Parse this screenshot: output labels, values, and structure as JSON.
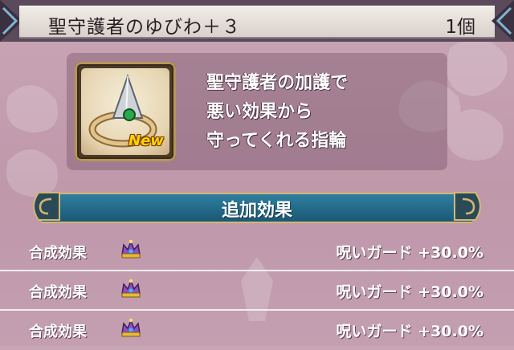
{
  "item": {
    "name": "聖守護者のゆびわ＋３",
    "count": "1個",
    "badge": "New",
    "icon": "ring-icon",
    "description": "聖守護者の加護で\n悪い効果から\n守ってくれる指輪"
  },
  "section": {
    "title": "追加効果"
  },
  "effects": [
    {
      "label": "合成効果",
      "icon": "crown-icon",
      "value": "呪いガード +30.0%"
    },
    {
      "label": "合成効果",
      "icon": "crown-icon",
      "value": "呪いガード +30.0%"
    },
    {
      "label": "合成効果",
      "icon": "crown-icon",
      "value": "呪いガード +30.0%"
    }
  ],
  "colors": {
    "background": "#c4a2b3",
    "header": "#5a4a5c",
    "banner": "#1f6a8a",
    "gold": "#d4b773",
    "badge": "#ffd400"
  }
}
